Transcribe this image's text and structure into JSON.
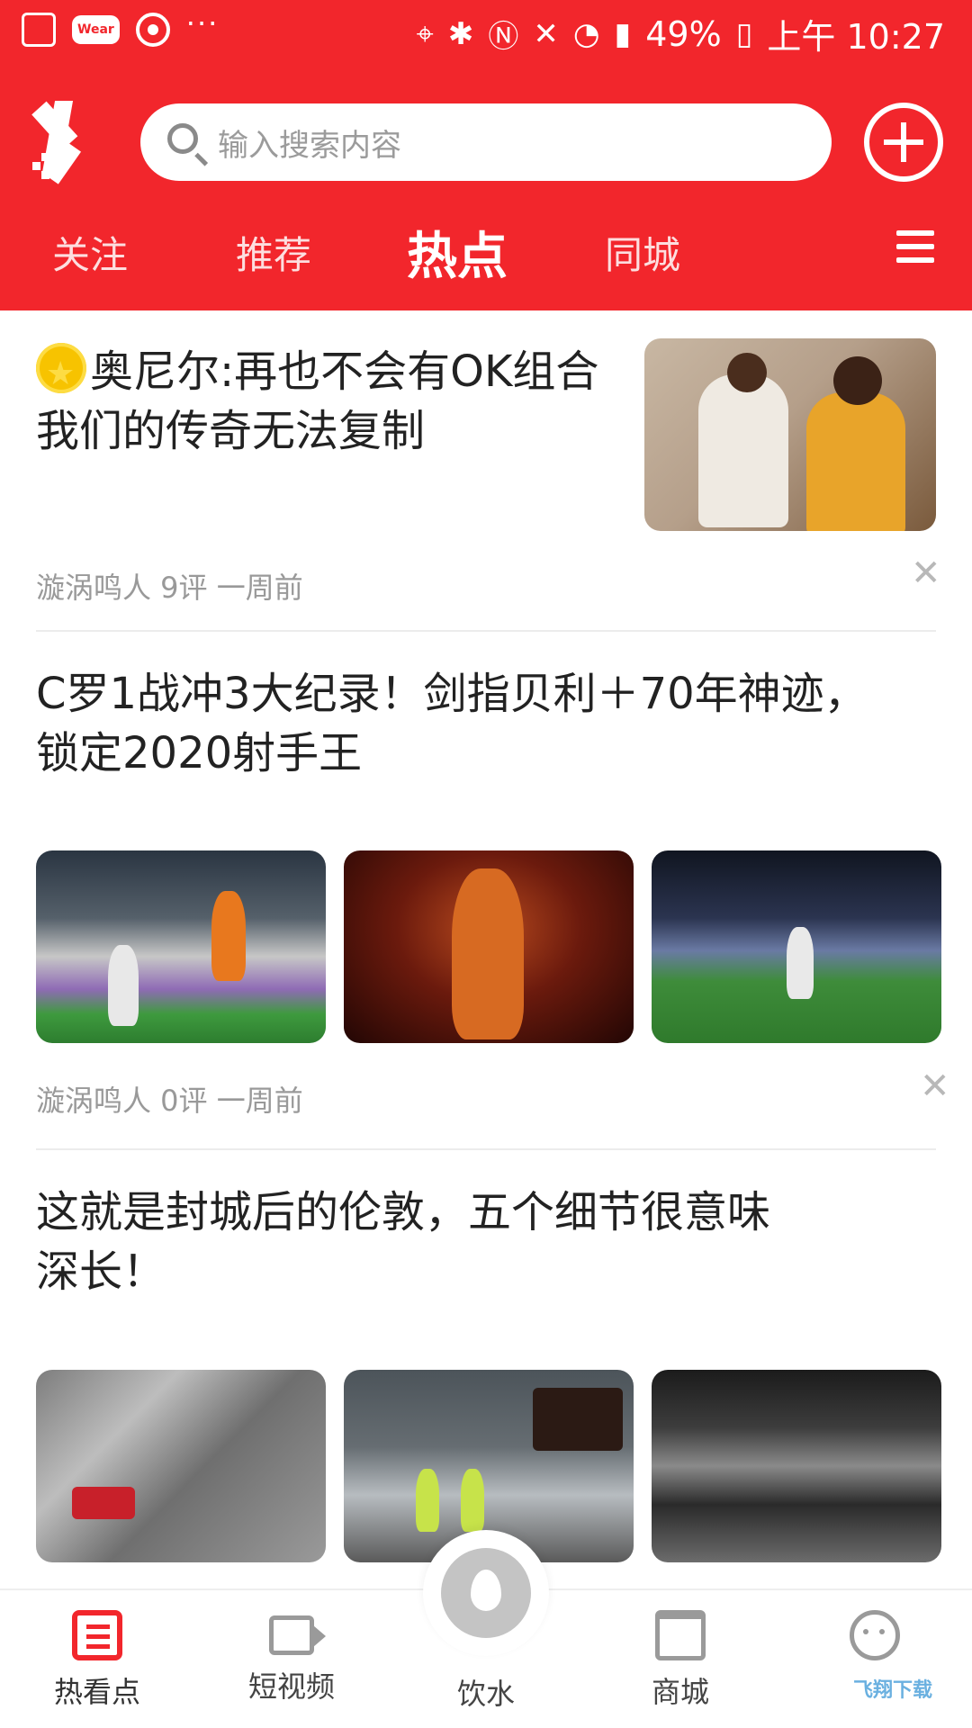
{
  "statusbar": {
    "battery": "49%",
    "time": "上午 10:27",
    "wear_label": "Wear",
    "dots": "···"
  },
  "header": {
    "search_placeholder": "输入搜索内容",
    "tabs": [
      {
        "label": "关注"
      },
      {
        "label": "推荐"
      },
      {
        "label": "热点"
      },
      {
        "label": "同城"
      }
    ],
    "active_tab": "热点",
    "accent_color": "#f2262c"
  },
  "articles": [
    {
      "title": "奥尼尔:再也不会有OK组合 我们的传奇无法复制",
      "meta": "漩涡鸣人 9评 一周前"
    },
    {
      "title": "C罗1战冲3大纪录！剑指贝利＋70年神迹，锁定2020射手王",
      "meta": "漩涡鸣人 0评 一周前"
    },
    {
      "title": "这就是封城后的伦敦，五个细节很意味深长！"
    }
  ],
  "bottom_nav": [
    {
      "label": "热看点",
      "icon": "list-icon",
      "active": true
    },
    {
      "label": "短视频",
      "icon": "video-icon"
    },
    {
      "label": "饮水",
      "icon": "water-drop-icon"
    },
    {
      "label": "商城",
      "icon": "shop-icon"
    },
    {
      "label": "",
      "icon": "robot-icon"
    }
  ],
  "watermark": "飞翔下载"
}
